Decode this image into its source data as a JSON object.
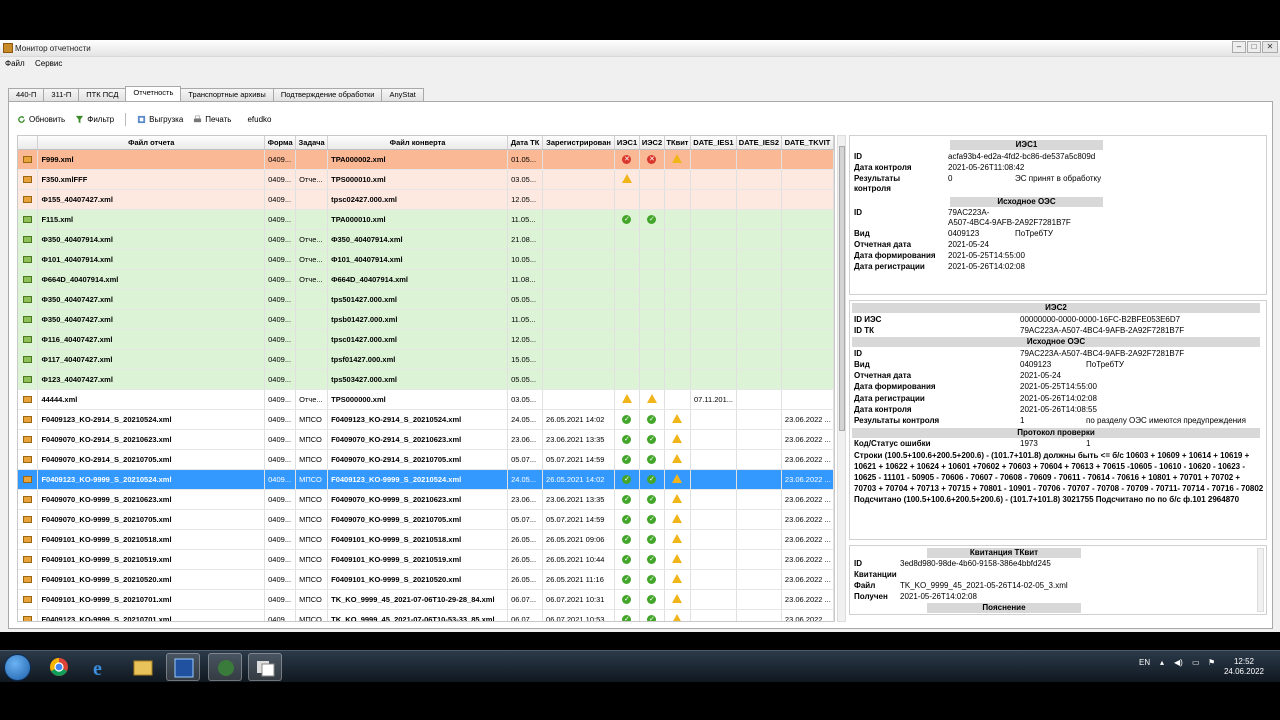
{
  "window": {
    "title": "Монитор отчетности"
  },
  "menu": [
    "Файл",
    "Сервис"
  ],
  "tabs": [
    "440-П",
    "311-П",
    "ПТК ПСД",
    "Отчетность",
    "Транспортные архивы",
    "Подтверждение обработки",
    "AnyStat"
  ],
  "active_tab": 3,
  "toolbar": {
    "refresh": "Обновить",
    "filter": "Фильтр",
    "export": "Выгрузка",
    "print": "Печать",
    "user": "efudko"
  },
  "columns": [
    "Файл отчета",
    "Форма",
    "Задача",
    "Файл конверта",
    "Дата ТК",
    "Зарегистрирован",
    "ИЭС1",
    "ИЭС2",
    "ТКвит",
    "DATE_IES1",
    "DATE_IES2",
    "DATE_TKVIT"
  ],
  "rows": [
    {
      "style": "orange",
      "file": "F999.xml",
      "form": "0409...",
      "task": "",
      "env": "TPA000002.xml",
      "dtk": "01.05...",
      "reg": "",
      "i1": "err",
      "i2": "err",
      "tk": "warn",
      "d1": "",
      "d2": "",
      "d3": ""
    },
    {
      "style": "peach",
      "file": "F350.xmlFFF",
      "form": "0409...",
      "task": "Отче...",
      "env": "TPS000010.xml",
      "dtk": "03.05...",
      "reg": "",
      "i1": "warn",
      "i2": "",
      "tk": "",
      "d1": "",
      "d2": "",
      "d3": ""
    },
    {
      "style": "peach",
      "file": "Ф155_40407427.xml",
      "form": "0409...",
      "task": "",
      "env": "tpsc02427.000.xml",
      "dtk": "12.05...",
      "reg": "",
      "i1": "",
      "i2": "",
      "tk": "",
      "d1": "",
      "d2": "",
      "d3": ""
    },
    {
      "style": "green",
      "file": "F115.xml",
      "form": "0409...",
      "task": "",
      "env": "TPA000010.xml",
      "dtk": "11.05...",
      "reg": "",
      "i1": "ok",
      "i2": "ok",
      "tk": "",
      "d1": "",
      "d2": "",
      "d3": ""
    },
    {
      "style": "green",
      "file": "Ф350_40407914.xml",
      "form": "0409...",
      "task": "Отче...",
      "env": "Ф350_40407914.xml",
      "dtk": "21.08...",
      "reg": "",
      "i1": "",
      "i2": "",
      "tk": "",
      "d1": "",
      "d2": "",
      "d3": ""
    },
    {
      "style": "green",
      "file": "Ф101_40407914.xml",
      "form": "0409...",
      "task": "Отче...",
      "env": "Ф101_40407914.xml",
      "dtk": "10.05...",
      "reg": "",
      "i1": "",
      "i2": "",
      "tk": "",
      "d1": "",
      "d2": "",
      "d3": ""
    },
    {
      "style": "green",
      "file": "Ф664D_40407914.xml",
      "form": "0409...",
      "task": "Отче...",
      "env": "Ф664D_40407914.xml",
      "dtk": "11.08...",
      "reg": "",
      "i1": "",
      "i2": "",
      "tk": "",
      "d1": "",
      "d2": "",
      "d3": ""
    },
    {
      "style": "green",
      "file": "Ф350_40407427.xml",
      "form": "0409...",
      "task": "",
      "env": "tps501427.000.xml",
      "dtk": "05.05...",
      "reg": "",
      "i1": "",
      "i2": "",
      "tk": "",
      "d1": "",
      "d2": "",
      "d3": ""
    },
    {
      "style": "green",
      "file": "Ф350_40407427.xml",
      "form": "0409...",
      "task": "",
      "env": "tpsb01427.000.xml",
      "dtk": "11.05...",
      "reg": "",
      "i1": "",
      "i2": "",
      "tk": "",
      "d1": "",
      "d2": "",
      "d3": ""
    },
    {
      "style": "green",
      "file": "Ф116_40407427.xml",
      "form": "0409...",
      "task": "",
      "env": "tpsc01427.000.xml",
      "dtk": "12.05...",
      "reg": "",
      "i1": "",
      "i2": "",
      "tk": "",
      "d1": "",
      "d2": "",
      "d3": ""
    },
    {
      "style": "green",
      "file": "Ф117_40407427.xml",
      "form": "0409...",
      "task": "",
      "env": "tpsf01427.000.xml",
      "dtk": "15.05...",
      "reg": "",
      "i1": "",
      "i2": "",
      "tk": "",
      "d1": "",
      "d2": "",
      "d3": ""
    },
    {
      "style": "green",
      "file": "Ф123_40407427.xml",
      "form": "0409...",
      "task": "",
      "env": "tps503427.000.xml",
      "dtk": "05.05...",
      "reg": "",
      "i1": "",
      "i2": "",
      "tk": "",
      "d1": "",
      "d2": "",
      "d3": ""
    },
    {
      "style": "white",
      "file": "44444.xml",
      "form": "0409...",
      "task": "Отче...",
      "env": "TPS000000.xml",
      "dtk": "03.05...",
      "reg": "",
      "i1": "warn",
      "i2": "warn",
      "tk": "",
      "d1": "07.11.201...",
      "d2": "",
      "d3": ""
    },
    {
      "style": "white",
      "file": "F0409123_KO-2914_S_20210524.xml",
      "form": "0409...",
      "task": "МПСО",
      "env": "F0409123_KO-2914_S_20210524.xml",
      "dtk": "24.05...",
      "reg": "26.05.2021 14:02",
      "i1": "ok",
      "i2": "ok",
      "tk": "warn",
      "d1": "",
      "d2": "",
      "d3": "23.06.2022 ..."
    },
    {
      "style": "white",
      "file": "F0409070_KO-2914_S_20210623.xml",
      "form": "0409...",
      "task": "МПСО",
      "env": "F0409070_KO-2914_S_20210623.xml",
      "dtk": "23.06...",
      "reg": "23.06.2021 13:35",
      "i1": "ok",
      "i2": "ok",
      "tk": "warn",
      "d1": "",
      "d2": "",
      "d3": "23.06.2022 ..."
    },
    {
      "style": "white",
      "file": "F0409070_KO-2914_S_20210705.xml",
      "form": "0409...",
      "task": "МПСО",
      "env": "F0409070_KO-2914_S_20210705.xml",
      "dtk": "05.07...",
      "reg": "05.07.2021 14:59",
      "i1": "ok",
      "i2": "ok",
      "tk": "warn",
      "d1": "",
      "d2": "",
      "d3": "23.06.2022 ..."
    },
    {
      "style": "sel",
      "file": "F0409123_KO-9999_S_20210524.xml",
      "form": "0409...",
      "task": "МПСО",
      "env": "F0409123_KO-9999_S_20210524.xml",
      "dtk": "24.05...",
      "reg": "26.05.2021 14:02",
      "i1": "ok",
      "i2": "ok",
      "tk": "warn",
      "d1": "",
      "d2": "",
      "d3": "23.06.2022 ..."
    },
    {
      "style": "white",
      "file": "F0409070_KO-9999_S_20210623.xml",
      "form": "0409...",
      "task": "МПСО",
      "env": "F0409070_KO-9999_S_20210623.xml",
      "dtk": "23.06...",
      "reg": "23.06.2021 13:35",
      "i1": "ok",
      "i2": "ok",
      "tk": "warn",
      "d1": "",
      "d2": "",
      "d3": "23.06.2022 ..."
    },
    {
      "style": "white",
      "file": "F0409070_KO-9999_S_20210705.xml",
      "form": "0409...",
      "task": "МПСО",
      "env": "F0409070_KO-9999_S_20210705.xml",
      "dtk": "05.07...",
      "reg": "05.07.2021 14:59",
      "i1": "ok",
      "i2": "ok",
      "tk": "warn",
      "d1": "",
      "d2": "",
      "d3": "23.06.2022 ..."
    },
    {
      "style": "white",
      "file": "F0409101_KO-9999_S_20210518.xml",
      "form": "0409...",
      "task": "МПСО",
      "env": "F0409101_KO-9999_S_20210518.xml",
      "dtk": "26.05...",
      "reg": "26.05.2021 09:06",
      "i1": "ok",
      "i2": "ok",
      "tk": "warn",
      "d1": "",
      "d2": "",
      "d3": "23.06.2022 ..."
    },
    {
      "style": "white",
      "file": "F0409101_KO-9999_S_20210519.xml",
      "form": "0409...",
      "task": "МПСО",
      "env": "F0409101_KO-9999_S_20210519.xml",
      "dtk": "26.05...",
      "reg": "26.05.2021 10:44",
      "i1": "ok",
      "i2": "ok",
      "tk": "warn",
      "d1": "",
      "d2": "",
      "d3": "23.06.2022 ..."
    },
    {
      "style": "white",
      "file": "F0409101_KO-9999_S_20210520.xml",
      "form": "0409...",
      "task": "МПСО",
      "env": "F0409101_KO-9999_S_20210520.xml",
      "dtk": "26.05...",
      "reg": "26.05.2021 11:16",
      "i1": "ok",
      "i2": "ok",
      "tk": "warn",
      "d1": "",
      "d2": "",
      "d3": "23.06.2022 ..."
    },
    {
      "style": "white",
      "file": "F0409101_KO-9999_S_20210701.xml",
      "form": "0409...",
      "task": "МПСО",
      "env": "TK_KO_9999_45_2021-07-06T10-29-28_84.xml",
      "dtk": "06.07...",
      "reg": "06.07.2021 10:31",
      "i1": "ok",
      "i2": "ok",
      "tk": "warn",
      "d1": "",
      "d2": "",
      "d3": "23.06.2022 ..."
    },
    {
      "style": "white",
      "file": "F0409123_KO-9999_S_20210701.xml",
      "form": "0409...",
      "task": "МПСО",
      "env": "TK_KO_9999_45_2021-07-06T10-53-33_85.xml",
      "dtk": "06.07...",
      "reg": "06.07.2021 10:53",
      "i1": "ok",
      "i2": "ok",
      "tk": "warn",
      "d1": "",
      "d2": "",
      "d3": "23.06.2022 ..."
    }
  ],
  "ies1": {
    "header": "ИЭС1",
    "id_label": "ID",
    "id": "acfa93b4-ed2a-4fd2-bc86-de537a5c809d",
    "date_label": "Дата контроля",
    "date": "2021-05-26T11:08:42",
    "res_label1": "Результаты",
    "res_label2": "контроля",
    "res_code": "0",
    "res_text": "ЭС принят в обработку",
    "src_header": "Исходное ОЭС",
    "src_id_label": "ID",
    "src_id1": "79AC223A-",
    "src_id2": "A507-4BC4-9AFB-2A92F7281B7F",
    "kind_label": "Вид",
    "kind_code": "0409123",
    "kind_name": "ПоТребТУ",
    "rep_label": "Отчетная дата",
    "rep": "2021-05-24",
    "form_label": "Дата формирования",
    "form": "2021-05-25T14:55:00",
    "reg_label": "Дата регистрации",
    "reg": "2021-05-26T14:02:08"
  },
  "ies2": {
    "header": "ИЭС2",
    "ies_id_label": "ID ИЭС",
    "ies_id": "00000000-0000-0000-16FC-B2BFE053E6D7",
    "tk_id_label": "ID ТК",
    "tk_id": "79AC223A-A507-4BC4-9AFB-2A92F7281B7F",
    "src_header": "Исходное ОЭС",
    "id_label": "ID",
    "id": "79AC223A-A507-4BC4-9AFB-2A92F7281B7F",
    "kind_label": "Вид",
    "kind_code": "0409123",
    "kind_name": "ПоТребТУ",
    "rep_label": "Отчетная дата",
    "rep": "2021-05-24",
    "form_label": "Дата формирования",
    "form": "2021-05-25T14:55:00",
    "reg_label": "Дата регистрации",
    "reg": "2021-05-26T14:02:08",
    "ctrl_label": "Дата контроля",
    "ctrl": "2021-05-26T14:08:55",
    "res_label": "Результаты контроля",
    "res_code": "1",
    "res_text": "по разделу ОЭС имеются предупреждения",
    "prot_header": "Протокол проверки",
    "err_label": "Код/Статус ошибки",
    "err_code": "1973",
    "err_status": "1",
    "message": "Строки (100.5+100.6+200.5+200.6) - (101.7+101.8) должны быть <= б/с 10603 + 10609 + 10614 + 10619 + 10621 + 10622 + 10624 + 10601 +70602 + 70603 + 70604 + 70613 + 70615 -10605 - 10610 - 10620 - 10623 - 10625 - 11101 - 50905 - 70606 - 70607 - 70608 - 70609 - 70611 - 70614 - 70616 + 10801 + 70701 + 70702 + 70703 + 70704 + 70713 + 70715 + 70801 - 10901 - 70706 - 70707 - 70708 - 70709 - 70711- 70714 - 70716 - 70802 Подсчитано (100.5+100.6+200.5+200.6) - (101.7+101.8) 3021755 Подсчитано по по б/с ф.101 2964870"
  },
  "tkvit": {
    "header": "Квитанция ТКвит",
    "id_label": "ID",
    "id": "3ed8d980-98de-4b60-9158-386e4bbfd245",
    "kv_label": "Квитанции",
    "file_label": "Файл",
    "file": "TK_KO_9999_45_2021-05-26T14-02-05_3.xml",
    "got_label": "Получен",
    "got": "2021-05-26T14:02:08",
    "expl_header": "Пояснение"
  },
  "taskbar": {
    "lang": "EN",
    "time": "12:52",
    "date": "24.06.2022"
  }
}
